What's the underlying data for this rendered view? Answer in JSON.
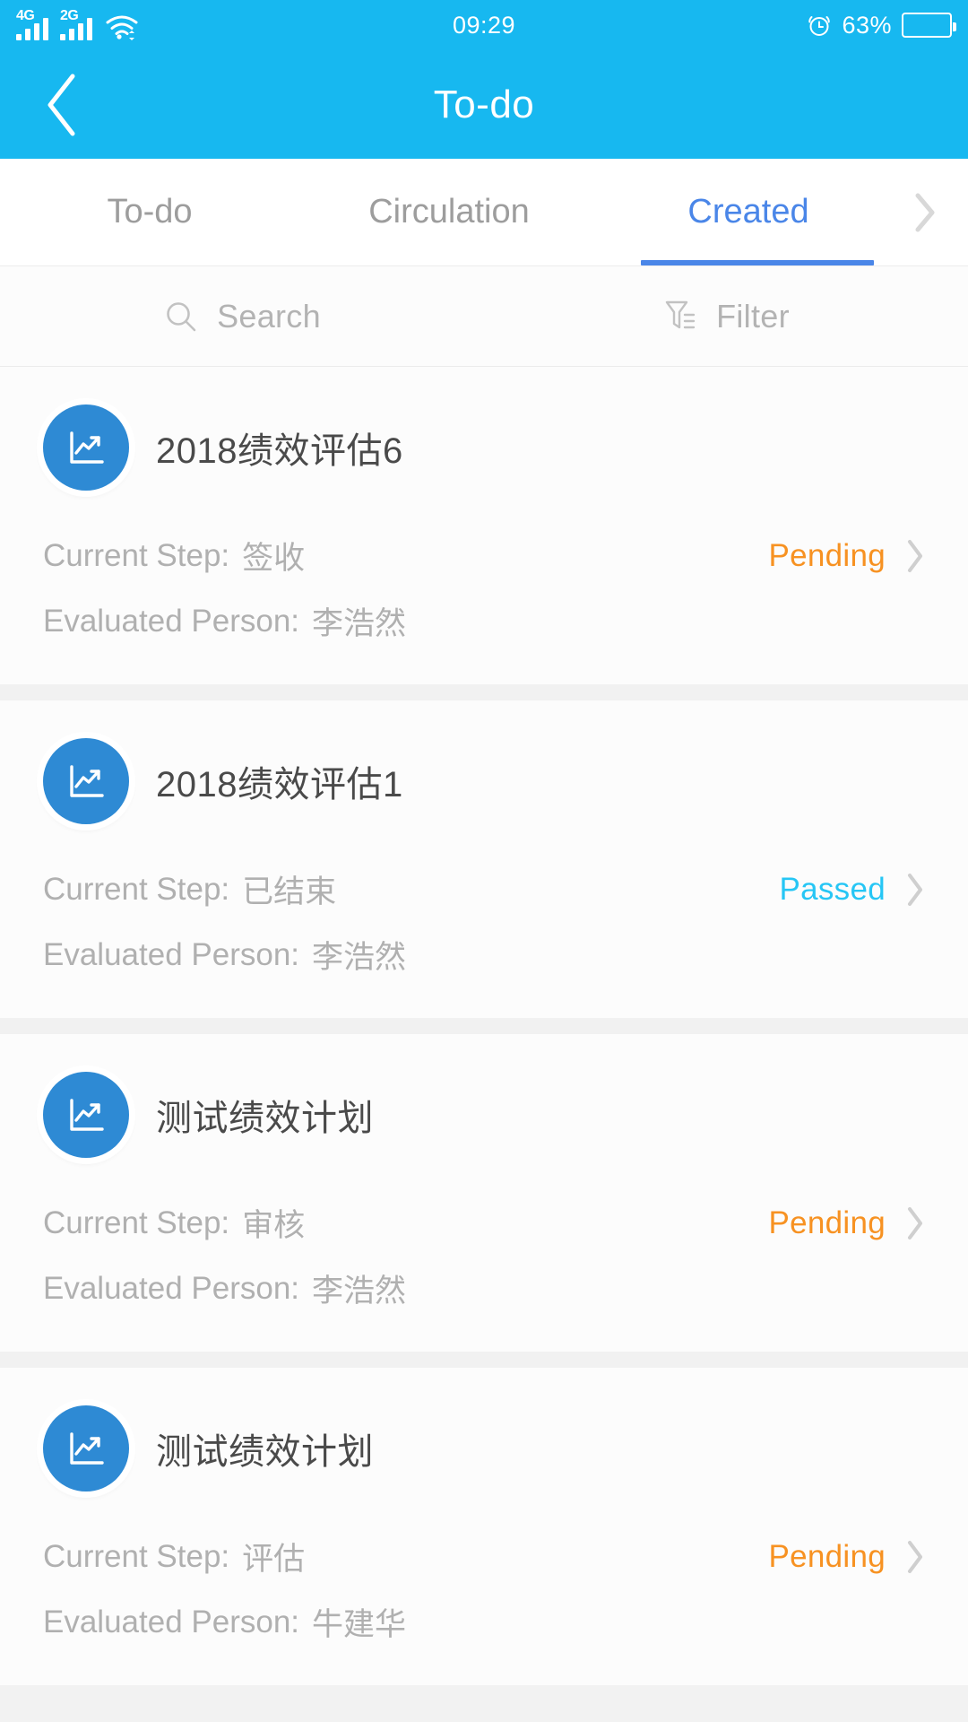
{
  "status_bar": {
    "sim1_network": "4G",
    "sim2_network": "2G",
    "wifi_icon": "wifi-icon",
    "time": "09:29",
    "alarm_icon": "alarm-clock-icon",
    "battery_percent": "63%",
    "battery_level": 60
  },
  "nav": {
    "back_icon": "chevron-left-icon",
    "title": "To-do"
  },
  "tabs": {
    "items": [
      {
        "label": "To-do",
        "active": false
      },
      {
        "label": "Circulation",
        "active": false
      },
      {
        "label": "Created",
        "active": true
      }
    ],
    "more_icon": "chevron-right-icon",
    "active_color": "#4a86e8",
    "inactive_color": "#9d9d9d"
  },
  "toolbar": {
    "search_icon": "search-icon",
    "search_label": "Search",
    "filter_icon": "filter-icon",
    "filter_label": "Filter"
  },
  "list": {
    "step_label": "Current Step:",
    "person_label": "Evaluated Person:",
    "row_chevron_icon": "chevron-right-icon",
    "item_icon": "chart-trending-up-icon",
    "items": [
      {
        "title": "2018绩效评估6",
        "current_step": "签收",
        "evaluated_person": "李浩然",
        "status": "Pending",
        "status_kind": "pending"
      },
      {
        "title": "2018绩效评估1",
        "current_step": "已结束",
        "evaluated_person": "李浩然",
        "status": "Passed",
        "status_kind": "passed"
      },
      {
        "title": "测试绩效计划",
        "current_step": "审核",
        "evaluated_person": "李浩然",
        "status": "Pending",
        "status_kind": "pending"
      },
      {
        "title": "测试绩效计划",
        "current_step": "评估",
        "evaluated_person": "牛建华",
        "status": "Pending",
        "status_kind": "pending"
      }
    ]
  },
  "colors": {
    "brand_blue": "#17b8f0",
    "accent_blue": "#4a86e8",
    "pending_orange": "#f79222",
    "passed_cyan": "#26c6f5",
    "avatar_blue": "#2e8ad4"
  }
}
